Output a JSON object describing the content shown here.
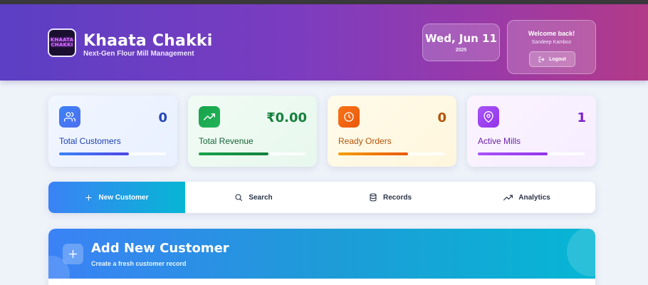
{
  "header": {
    "logo_text_top": "KHAATA",
    "logo_text_bottom": "CHAKKI",
    "title": "Khaata Chakki",
    "subtitle": "Next-Gen Flour Mill Management",
    "date": "Wed, Jun 11",
    "year": "2025",
    "welcome": "Welcome back!",
    "user": "Sandeep Kamboz",
    "logout_label": "Logout"
  },
  "stats": [
    {
      "label": "Total Customers",
      "value": "0",
      "icon": "users-icon",
      "progress": 0.65
    },
    {
      "label": "Total Revenue",
      "value": "₹0.00",
      "icon": "trending-up-icon",
      "progress": 0.65
    },
    {
      "label": "Ready Orders",
      "value": "0",
      "icon": "clock-icon",
      "progress": 0.65
    },
    {
      "label": "Active Mills",
      "value": "1",
      "icon": "map-pin-icon",
      "progress": 0.65
    }
  ],
  "tabs": [
    {
      "label": "New Customer",
      "icon": "plus-icon",
      "active": true
    },
    {
      "label": "Search",
      "icon": "search-icon",
      "active": false
    },
    {
      "label": "Records",
      "icon": "database-icon",
      "active": false
    },
    {
      "label": "Analytics",
      "icon": "trending-up-icon",
      "active": false
    }
  ],
  "panel": {
    "title": "Add New Customer",
    "subtitle": "Create a fresh customer record"
  },
  "colors": {
    "customers": "#3b82f6",
    "revenue": "#16a34a",
    "orders": "#f97316",
    "mills": "#a855f7"
  }
}
